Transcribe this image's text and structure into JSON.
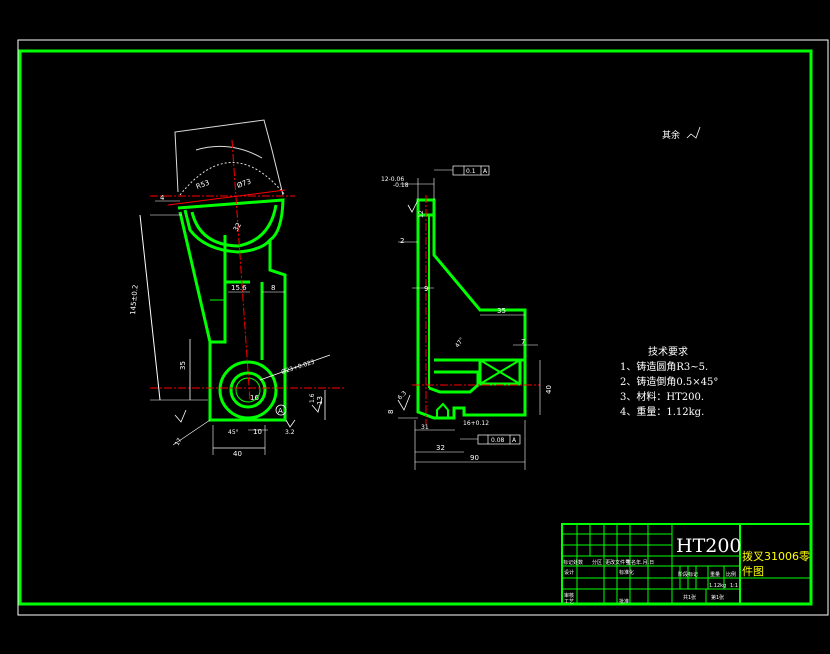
{
  "notes": {
    "title": "技术要求",
    "items": [
      "1、铸造圆角R3~5.",
      "2、铸造倒角0.5×45°",
      "3、材料：HT200.",
      "4、重量：1.12kg."
    ]
  },
  "roughness_mark": "其余",
  "title_block": {
    "material": "HT200",
    "part_name": "拨叉31006零件图",
    "row_labels": [
      "标记处数",
      "分区",
      "更改文件号",
      "签名",
      "年.月.日"
    ],
    "designer": "设计",
    "standardization": "标准化",
    "checker": "审核",
    "process": "工艺",
    "approve": "批准",
    "stage_mark": "阶段标记",
    "weight": "重量",
    "scale": "比例",
    "weight_value": "1.12kg",
    "scale_value": "1:1",
    "sheets_total": "共1张",
    "sheet_no": "第1张"
  },
  "dimensions": {
    "r53": "R53",
    "r73": "Ø73",
    "d4": "4",
    "r3": "3",
    "d32": "32",
    "d156": "15.6",
    "d8": "8",
    "d145": "145±0.2",
    "d35": "35",
    "d_hole": "Ø23+0.023",
    "d16": "16",
    "d1_6": "1.6",
    "d13": "13",
    "d3_2": "3.2",
    "d45": "45°",
    "d10": "10",
    "d40": "40",
    "d17": "17",
    "sym_a": "A",
    "tol1": "12-0.06",
    "tol1b": "-0.18",
    "fcf1": "0.1",
    "fcf_ref": "A",
    "d2": "2",
    "d9": "9",
    "d35b": "35",
    "d47": "47°",
    "d7": "7",
    "d40b": "40",
    "d8b": "8",
    "d6_3": "6.3",
    "d31": "31",
    "d16b": "16+0.12",
    "fcf2": "0.08",
    "d32b": "32",
    "d90": "90",
    "d12": "12"
  }
}
